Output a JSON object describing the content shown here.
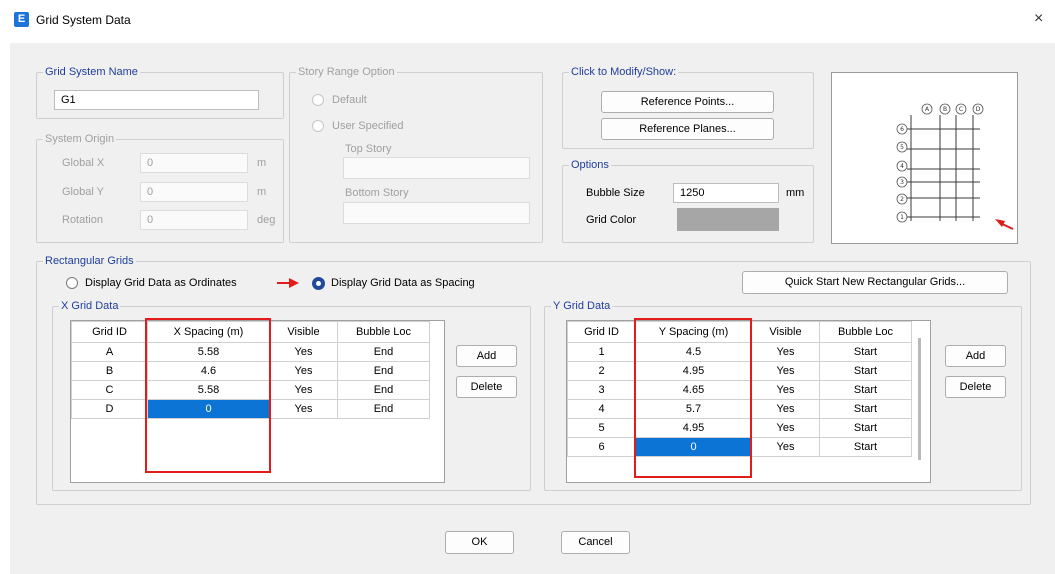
{
  "window": {
    "app_icon": "E",
    "title": "Grid System Data",
    "close_glyph": "×"
  },
  "grid_system_name": {
    "label": "Grid System Name",
    "value": "G1"
  },
  "system_origin": {
    "label": "System Origin",
    "rows": [
      {
        "label": "Global  X",
        "value": "0",
        "unit": "m"
      },
      {
        "label": "Global  Y",
        "value": "0",
        "unit": "m"
      },
      {
        "label": "Rotation",
        "value": "0",
        "unit": "deg"
      }
    ]
  },
  "story_range": {
    "label": "Story Range Option",
    "default_label": "Default",
    "user_label": "User Specified",
    "top_story_label": "Top Story",
    "bottom_story_label": "Bottom Story"
  },
  "click_modify": {
    "label": "Click to Modify/Show:",
    "ref_points": "Reference Points...",
    "ref_planes": "Reference Planes..."
  },
  "options": {
    "label": "Options",
    "bubble_size_label": "Bubble Size",
    "bubble_size_value": "1250",
    "bubble_size_unit": "mm",
    "grid_color_label": "Grid Color",
    "grid_color": "#a6a6a6"
  },
  "preview": {
    "x_bubbles": [
      "A",
      "B",
      "C",
      "D"
    ],
    "y_bubbles": [
      "6",
      "5",
      "4",
      "3",
      "2",
      "1"
    ]
  },
  "rect_grids": {
    "label": "Rectangular Grids",
    "ordinates_label": "Display Grid Data as Ordinates",
    "spacing_label": "Display Grid Data as Spacing",
    "quick_start": "Quick Start New Rectangular Grids..."
  },
  "x_grid": {
    "label": "X Grid Data",
    "headers": [
      "Grid ID",
      "X Spacing  (m)",
      "Visible",
      "Bubble Loc"
    ],
    "rows": [
      [
        "A",
        "5.58",
        "Yes",
        "End"
      ],
      [
        "B",
        "4.6",
        "Yes",
        "End"
      ],
      [
        "C",
        "5.58",
        "Yes",
        "End"
      ],
      [
        "D",
        "0",
        "Yes",
        "End"
      ]
    ],
    "add": "Add",
    "delete": "Delete"
  },
  "y_grid": {
    "label": "Y Grid Data",
    "headers": [
      "Grid ID",
      "Y Spacing  (m)",
      "Visible",
      "Bubble Loc"
    ],
    "rows": [
      [
        "1",
        "4.5",
        "Yes",
        "Start"
      ],
      [
        "2",
        "4.95",
        "Yes",
        "Start"
      ],
      [
        "3",
        "4.65",
        "Yes",
        "Start"
      ],
      [
        "4",
        "5.7",
        "Yes",
        "Start"
      ],
      [
        "5",
        "4.95",
        "Yes",
        "Start"
      ],
      [
        "6",
        "0",
        "Yes",
        "Start"
      ]
    ],
    "add": "Add",
    "delete": "Delete"
  },
  "footer": {
    "ok": "OK",
    "cancel": "Cancel"
  },
  "colors": {
    "annotation_red": "#e21b1b",
    "selection_blue": "#0b74d4",
    "header_blue": "#1f3e9c"
  }
}
